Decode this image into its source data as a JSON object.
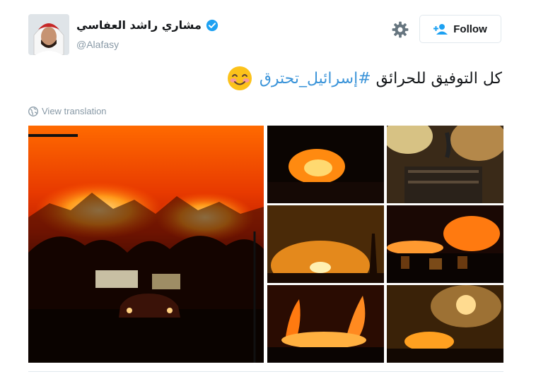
{
  "user": {
    "display_name": "مشاري راشد العفاسي",
    "handle": "@Alafasy",
    "verified": true
  },
  "actions": {
    "follow_label": "Follow"
  },
  "tweet": {
    "text_plain": "كل التوفيق للحرائق",
    "hashtag": "#إسرائيل_تحترق",
    "emoji": "smiling-face-with-smiling-eyes"
  },
  "translate_label": "View translation",
  "colors": {
    "hashtag": "#3b94d9",
    "muted": "#8899a6",
    "verified": "#1da1f2",
    "border": "#e1e8ed"
  },
  "media": {
    "count": 7,
    "layout": "1 large left + 2x3 grid right"
  }
}
